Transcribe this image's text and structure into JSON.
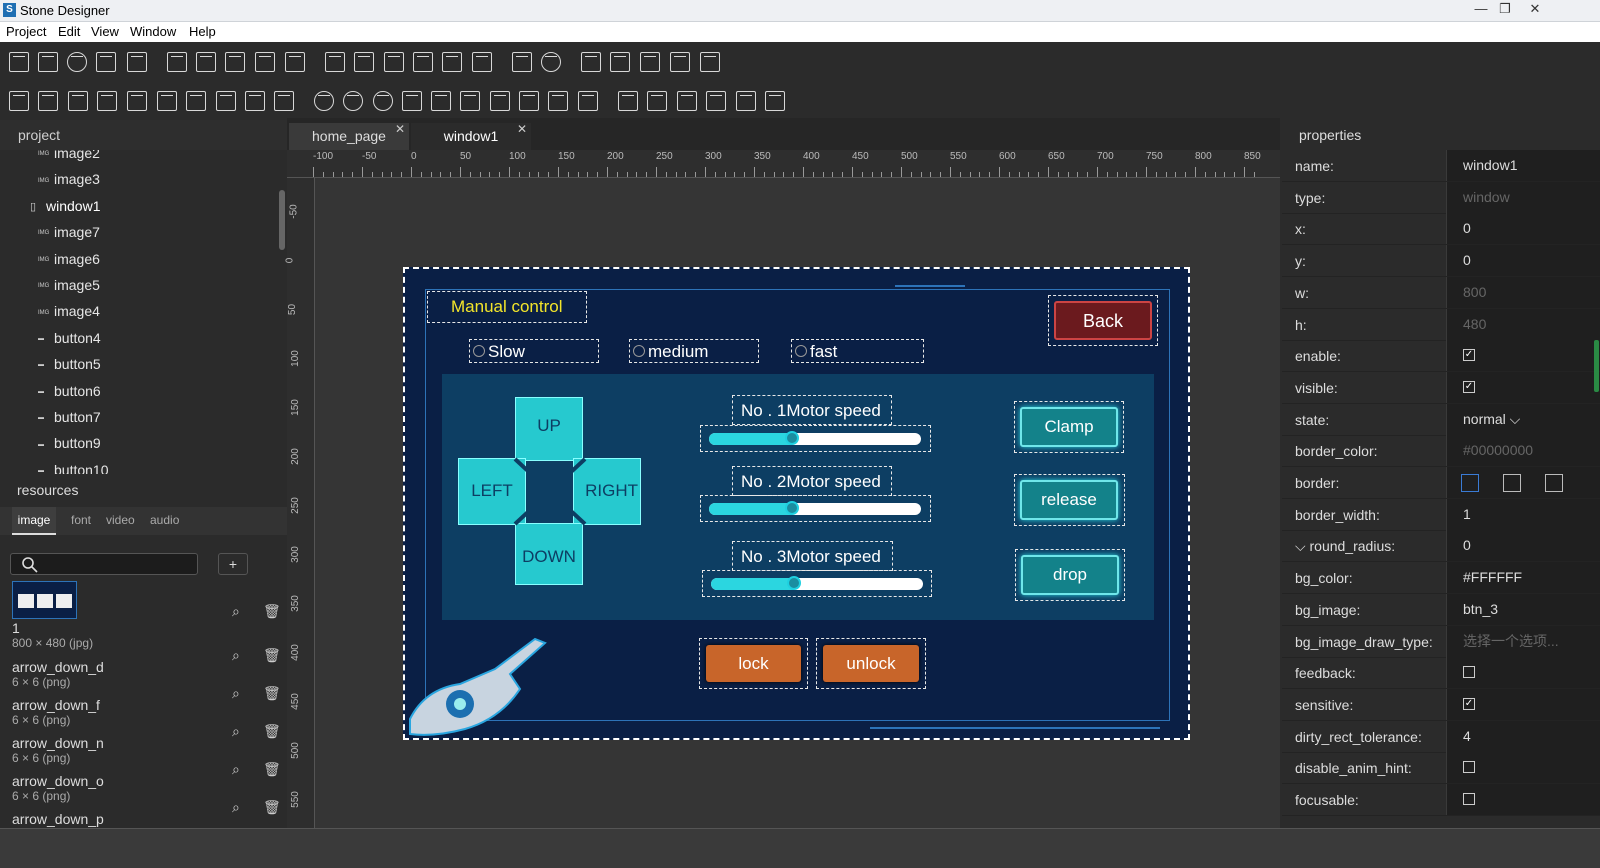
{
  "window": {
    "title": "Stone Designer",
    "minimize": "—",
    "restore": "❐",
    "close": "✕"
  },
  "menu": [
    "Project",
    "Edit",
    "View",
    "Window",
    "Help"
  ],
  "toolbar1_icons": [
    "btn-icon",
    "checkbox-icon",
    "radio-icon",
    "switch-icon",
    "list-icon",
    "chart-line-icon",
    "image-gif-icon",
    "image-svg-icon",
    "image-icon",
    "image-animation-icon",
    "edit-icon",
    "edit-multi-icon",
    "edit-text-icon",
    "label-icon",
    "label-text-icon",
    "label-font-icon",
    "slider-settings-icon",
    "progress-circle-icon",
    "image-button-icon",
    "slider-vertical-icon",
    "download-icon",
    "lock-icon",
    "unlock-icon"
  ],
  "toolbar2_icons": [
    "underline-icon",
    "table-icon",
    "combo-icon",
    "list-view-icon",
    "list-bullet-icon",
    "list-number-icon",
    "screen-icon",
    "monitor-icon",
    "scroll-v-icon",
    "scroll-bar-icon",
    "clock-icon",
    "digit-clock-icon",
    "gauge-icon",
    "thermometer-icon",
    "rows-icon",
    "columns-icon",
    "split-h-icon",
    "split-v-icon",
    "split-center-icon",
    "frame-icon",
    "grid-icon",
    "list-lines-icon",
    "crop-icon",
    "move-icon",
    "barcode-icon",
    "qrcode-icon"
  ],
  "project": {
    "header": "project",
    "items": [
      {
        "label": "image2",
        "type": "img"
      },
      {
        "label": "image3",
        "type": "img"
      },
      {
        "label": "window1",
        "type": "win"
      },
      {
        "label": "image7",
        "type": "img"
      },
      {
        "label": "image6",
        "type": "img"
      },
      {
        "label": "image5",
        "type": "img"
      },
      {
        "label": "image4",
        "type": "img"
      },
      {
        "label": "button4",
        "type": "btn"
      },
      {
        "label": "button5",
        "type": "btn"
      },
      {
        "label": "button6",
        "type": "btn"
      },
      {
        "label": "button7",
        "type": "btn"
      },
      {
        "label": "button9",
        "type": "btn"
      },
      {
        "label": "button10",
        "type": "btn"
      }
    ]
  },
  "resources": {
    "header": "resources",
    "tabs": [
      "image",
      "font",
      "video",
      "audio"
    ],
    "add": "+",
    "items": [
      {
        "name": "1",
        "size": "800 × 480 (jpg)"
      },
      {
        "name": "arrow_down_d",
        "size": "6 × 6 (png)"
      },
      {
        "name": "arrow_down_f",
        "size": "6 × 6 (png)"
      },
      {
        "name": "arrow_down_n",
        "size": "6 × 6 (png)"
      },
      {
        "name": "arrow_down_o",
        "size": "6 × 6 (png)"
      },
      {
        "name": "arrow_down_p",
        "size": ""
      }
    ]
  },
  "tabs": [
    {
      "label": "home_page",
      "close": "✕"
    },
    {
      "label": "window1",
      "close": "✕"
    }
  ],
  "ruler_h": [
    "-100",
    "-50",
    "0",
    "50",
    "100",
    "150",
    "200",
    "250",
    "300",
    "350",
    "400",
    "450",
    "500",
    "550",
    "600",
    "650",
    "700",
    "750",
    "800",
    "850"
  ],
  "ruler_v": [
    "-50",
    "0",
    "50",
    "100",
    "150",
    "200",
    "250",
    "300",
    "350",
    "400",
    "450",
    "500",
    "550"
  ],
  "design": {
    "title": "Manual control",
    "back": "Back",
    "speeds": [
      "Slow",
      "medium",
      "fast"
    ],
    "dpad": {
      "up": "UP",
      "left": "LEFT",
      "right": "RIGHT",
      "down": "DOWN"
    },
    "motors": [
      {
        "label": "No . 1Motor speed",
        "value": 0.39
      },
      {
        "label": "No . 2Motor speed",
        "value": 0.39
      },
      {
        "label": "No . 3Motor speed",
        "value": 0.39
      }
    ],
    "actions": [
      "Clamp",
      "release",
      "drop"
    ],
    "lock": "lock",
    "unlock": "unlock"
  },
  "properties": {
    "header": "properties",
    "rows": [
      {
        "k": "name:",
        "v": "window1"
      },
      {
        "k": "type:",
        "v": "window",
        "dim": true
      },
      {
        "k": "x:",
        "v": "0"
      },
      {
        "k": "y:",
        "v": "0"
      },
      {
        "k": "w:",
        "v": "800",
        "dim": true
      },
      {
        "k": "h:",
        "v": "480",
        "dim": true
      },
      {
        "k": "enable:",
        "check": true
      },
      {
        "k": "visible:",
        "check": true
      },
      {
        "k": "state:",
        "v": "normal ⌵"
      },
      {
        "k": "border_color:",
        "v": "#00000000",
        "dim": true
      },
      {
        "k": "border:",
        "v": ""
      },
      {
        "k": "border_width:",
        "v": "1"
      },
      {
        "k": "⌵  round_radius:",
        "v": "0"
      },
      {
        "k": "bg_color:",
        "v": "#FFFFFF"
      },
      {
        "k": "bg_image:",
        "v": "btn_3"
      },
      {
        "k": "bg_image_draw_type:",
        "v": "选择一个选项...",
        "dim": true
      },
      {
        "k": "feedback:",
        "check": false
      },
      {
        "k": "sensitive:",
        "check": true
      },
      {
        "k": "dirty_rect_tolerance:",
        "v": "4"
      },
      {
        "k": "disable_anim_hint:",
        "check": false
      },
      {
        "k": "focusable:",
        "check": false
      }
    ]
  }
}
